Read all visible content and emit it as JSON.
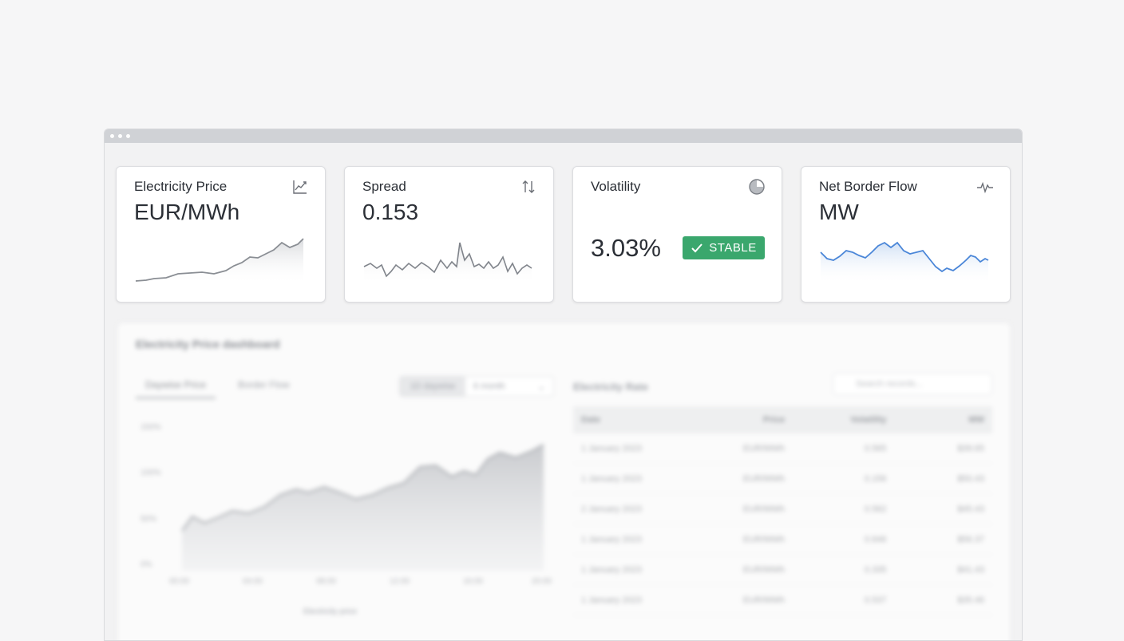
{
  "cards": [
    {
      "title": "Electricity Price",
      "value": "EUR/MWh",
      "icon": "trend-chart-icon"
    },
    {
      "title": "Spread",
      "value": "0.153",
      "icon": "swap-vertical-icon"
    },
    {
      "title": "Volatility",
      "value": "3.03%",
      "icon": "pie-clock-icon",
      "badge": "STABLE",
      "badge_color": "#3aa76d"
    },
    {
      "title": "Net Border Flow",
      "value": "MW",
      "icon": "pulse-icon",
      "accent": "#4a86d8"
    }
  ],
  "panel": {
    "title": "Electricity Price dashboard",
    "tabs": [
      "Daywise Price",
      "Border Flow"
    ],
    "range_options": [
      "1D daywise",
      "6 month"
    ],
    "y_ticks": [
      "150%",
      "100%",
      "50%",
      "0%"
    ],
    "x_ticks": [
      "00:00",
      "04:00",
      "08:00",
      "12:00",
      "16:00",
      "20:00"
    ],
    "legend": "Electricity price"
  },
  "table": {
    "title": "Electricity Rate",
    "search_placeholder": "Search records...",
    "columns": [
      "Date",
      "Price",
      "Volatility",
      "MW"
    ],
    "rows": [
      [
        "1 January 2023",
        "EUR/MWh",
        "0.565",
        "$39.65"
      ],
      [
        "1 January 2023",
        "EUR/MWh",
        "0.156",
        "$50.43"
      ],
      [
        "2 January 2023",
        "EUR/MWh",
        "0.562",
        "$45.43"
      ],
      [
        "1 January 2023",
        "EUR/MWh",
        "0.646",
        "$56.37"
      ],
      [
        "1 January 2023",
        "EUR/MWh",
        "0.335",
        "$41.43"
      ],
      [
        "1 January 2023",
        "EUR/MWh",
        "0.537",
        "$35.46"
      ]
    ]
  }
}
